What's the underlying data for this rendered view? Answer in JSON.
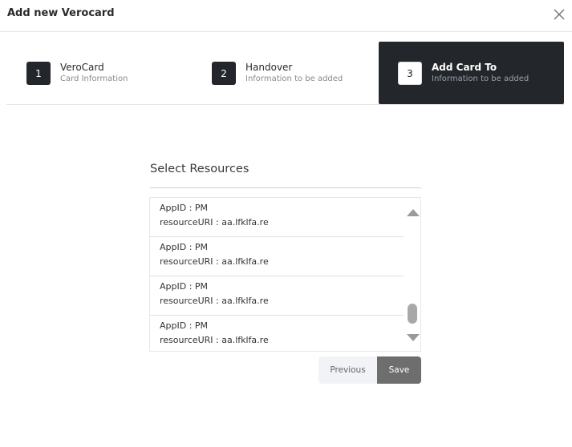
{
  "modal": {
    "title": "Add new Verocard"
  },
  "steps": [
    {
      "number": "1",
      "title": "VeroCard",
      "subtitle": "Card Information"
    },
    {
      "number": "2",
      "title": "Handover",
      "subtitle": "Information to be added"
    },
    {
      "number": "3",
      "title": "Add Card To",
      "subtitle": "Information to be added"
    }
  ],
  "resources": {
    "title": "Select Resources",
    "items": [
      {
        "line1": "AppID : PM",
        "line2": "resourceURI : aa.lfklfa.re"
      },
      {
        "line1": "AppID : PM",
        "line2": "resourceURI : aa.lfklfa.re"
      },
      {
        "line1": "AppID : PM",
        "line2": "resourceURI : aa.lfklfa.re"
      },
      {
        "line1": "AppID : PM",
        "line2": "resourceURI : aa.lfklfa.re"
      }
    ]
  },
  "buttons": {
    "previous": "Previous",
    "save": "Save"
  },
  "colors": {
    "active_step_bg": "#23262b",
    "save_button_bg": "#6e6e6e",
    "previous_button_bg": "#f2f3f6"
  },
  "icons": {
    "close": "close-icon",
    "scroll_up": "triangle-up-icon",
    "scroll_down": "triangle-down-icon"
  }
}
